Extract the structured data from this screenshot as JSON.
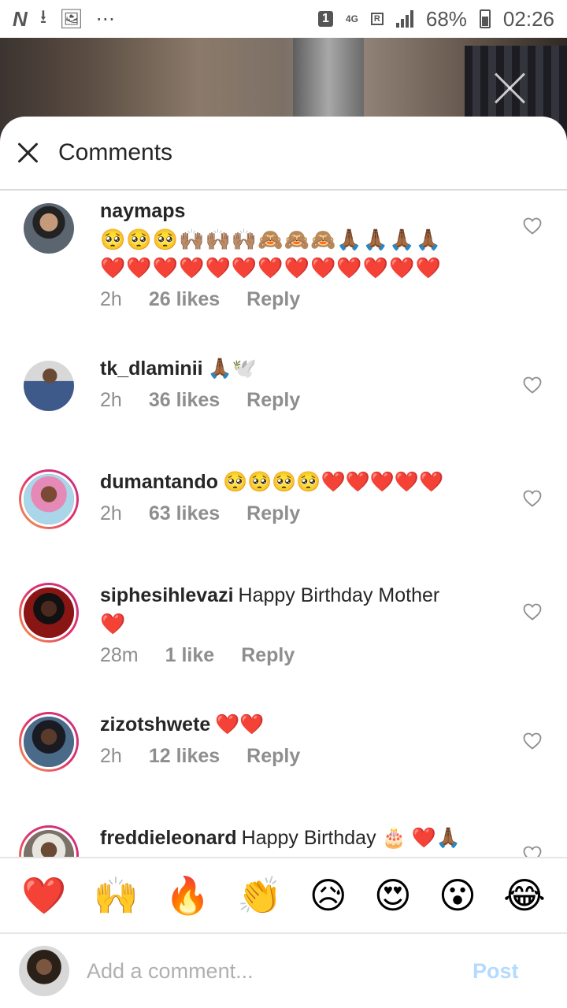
{
  "status_bar": {
    "icons": [
      "n-icon",
      "download-icon",
      "image-icon",
      "more-dots-icon",
      "sim-1-icon",
      "4g-icon",
      "signal-icon"
    ],
    "sim_badge": "1",
    "network": "4G",
    "roaming": "R",
    "battery": "68%",
    "time": "02:26"
  },
  "sheet": {
    "title": "Comments"
  },
  "comments": [
    {
      "username": "naymaps",
      "text_line1": "🥺🥺🥺🙌🏽🙌🏽🙌🏽🙈🙈🙈🙏🏾🙏🏾🙏🏾🙏🏾",
      "text_line2": "❤️❤️❤️❤️❤️❤️❤️❤️❤️❤️❤️❤️❤️",
      "time": "2h",
      "likes": "26 likes",
      "reply": "Reply",
      "avatar_color": "#4a5560"
    },
    {
      "username": "tk_dlaminii",
      "text": "🙏🏾🕊️",
      "time": "2h",
      "likes": "36 likes",
      "reply": "Reply",
      "avatar_color": "#3d5a8a"
    },
    {
      "username": "dumantando",
      "text": "🥺🥺🥺🥺❤️❤️❤️❤️❤️",
      "time": "2h",
      "likes": "63 likes",
      "reply": "Reply",
      "avatar_color": "#e58ab6"
    },
    {
      "username": "siphesihlevazi",
      "text": "Happy Birthday Mother",
      "text_line2": "❤️",
      "time": "28m",
      "likes": "1 like",
      "reply": "Reply",
      "avatar_color": "#8a1515"
    },
    {
      "username": "zizotshwete",
      "text": "❤️❤️",
      "time": "2h",
      "likes": "12 likes",
      "reply": "Reply",
      "avatar_color": "#2e3a4a"
    },
    {
      "username": "freddieleonard",
      "text": "Happy Birthday 🎂 ❤️🙏🏾",
      "avatar_color": "#7a7268"
    }
  ],
  "reactions": [
    "❤️",
    "🙌",
    "🔥",
    "👏",
    "😥",
    "😍",
    "😮",
    "😂"
  ],
  "composer": {
    "placeholder": "Add a comment...",
    "post_label": "Post",
    "avatar_color": "#5a6a7a"
  }
}
